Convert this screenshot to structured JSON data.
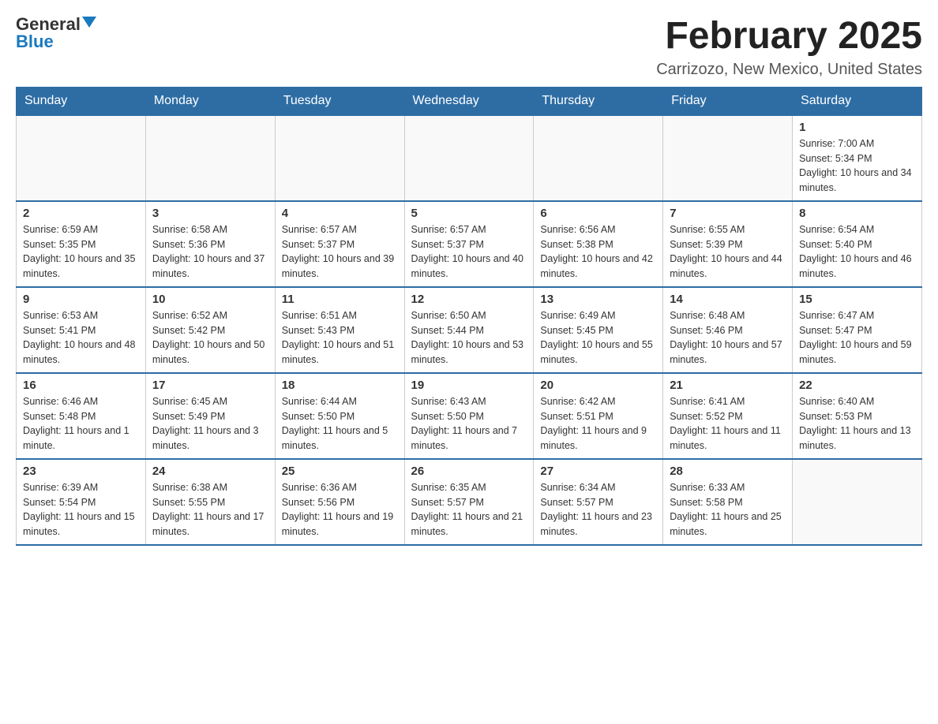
{
  "header": {
    "logo_general": "General",
    "logo_blue": "Blue",
    "month_title": "February 2025",
    "location": "Carrizozo, New Mexico, United States"
  },
  "days_of_week": [
    "Sunday",
    "Monday",
    "Tuesday",
    "Wednesday",
    "Thursday",
    "Friday",
    "Saturday"
  ],
  "weeks": [
    [
      {
        "day": "",
        "info": ""
      },
      {
        "day": "",
        "info": ""
      },
      {
        "day": "",
        "info": ""
      },
      {
        "day": "",
        "info": ""
      },
      {
        "day": "",
        "info": ""
      },
      {
        "day": "",
        "info": ""
      },
      {
        "day": "1",
        "info": "Sunrise: 7:00 AM\nSunset: 5:34 PM\nDaylight: 10 hours and 34 minutes."
      }
    ],
    [
      {
        "day": "2",
        "info": "Sunrise: 6:59 AM\nSunset: 5:35 PM\nDaylight: 10 hours and 35 minutes."
      },
      {
        "day": "3",
        "info": "Sunrise: 6:58 AM\nSunset: 5:36 PM\nDaylight: 10 hours and 37 minutes."
      },
      {
        "day": "4",
        "info": "Sunrise: 6:57 AM\nSunset: 5:37 PM\nDaylight: 10 hours and 39 minutes."
      },
      {
        "day": "5",
        "info": "Sunrise: 6:57 AM\nSunset: 5:37 PM\nDaylight: 10 hours and 40 minutes."
      },
      {
        "day": "6",
        "info": "Sunrise: 6:56 AM\nSunset: 5:38 PM\nDaylight: 10 hours and 42 minutes."
      },
      {
        "day": "7",
        "info": "Sunrise: 6:55 AM\nSunset: 5:39 PM\nDaylight: 10 hours and 44 minutes."
      },
      {
        "day": "8",
        "info": "Sunrise: 6:54 AM\nSunset: 5:40 PM\nDaylight: 10 hours and 46 minutes."
      }
    ],
    [
      {
        "day": "9",
        "info": "Sunrise: 6:53 AM\nSunset: 5:41 PM\nDaylight: 10 hours and 48 minutes."
      },
      {
        "day": "10",
        "info": "Sunrise: 6:52 AM\nSunset: 5:42 PM\nDaylight: 10 hours and 50 minutes."
      },
      {
        "day": "11",
        "info": "Sunrise: 6:51 AM\nSunset: 5:43 PM\nDaylight: 10 hours and 51 minutes."
      },
      {
        "day": "12",
        "info": "Sunrise: 6:50 AM\nSunset: 5:44 PM\nDaylight: 10 hours and 53 minutes."
      },
      {
        "day": "13",
        "info": "Sunrise: 6:49 AM\nSunset: 5:45 PM\nDaylight: 10 hours and 55 minutes."
      },
      {
        "day": "14",
        "info": "Sunrise: 6:48 AM\nSunset: 5:46 PM\nDaylight: 10 hours and 57 minutes."
      },
      {
        "day": "15",
        "info": "Sunrise: 6:47 AM\nSunset: 5:47 PM\nDaylight: 10 hours and 59 minutes."
      }
    ],
    [
      {
        "day": "16",
        "info": "Sunrise: 6:46 AM\nSunset: 5:48 PM\nDaylight: 11 hours and 1 minute."
      },
      {
        "day": "17",
        "info": "Sunrise: 6:45 AM\nSunset: 5:49 PM\nDaylight: 11 hours and 3 minutes."
      },
      {
        "day": "18",
        "info": "Sunrise: 6:44 AM\nSunset: 5:50 PM\nDaylight: 11 hours and 5 minutes."
      },
      {
        "day": "19",
        "info": "Sunrise: 6:43 AM\nSunset: 5:50 PM\nDaylight: 11 hours and 7 minutes."
      },
      {
        "day": "20",
        "info": "Sunrise: 6:42 AM\nSunset: 5:51 PM\nDaylight: 11 hours and 9 minutes."
      },
      {
        "day": "21",
        "info": "Sunrise: 6:41 AM\nSunset: 5:52 PM\nDaylight: 11 hours and 11 minutes."
      },
      {
        "day": "22",
        "info": "Sunrise: 6:40 AM\nSunset: 5:53 PM\nDaylight: 11 hours and 13 minutes."
      }
    ],
    [
      {
        "day": "23",
        "info": "Sunrise: 6:39 AM\nSunset: 5:54 PM\nDaylight: 11 hours and 15 minutes."
      },
      {
        "day": "24",
        "info": "Sunrise: 6:38 AM\nSunset: 5:55 PM\nDaylight: 11 hours and 17 minutes."
      },
      {
        "day": "25",
        "info": "Sunrise: 6:36 AM\nSunset: 5:56 PM\nDaylight: 11 hours and 19 minutes."
      },
      {
        "day": "26",
        "info": "Sunrise: 6:35 AM\nSunset: 5:57 PM\nDaylight: 11 hours and 21 minutes."
      },
      {
        "day": "27",
        "info": "Sunrise: 6:34 AM\nSunset: 5:57 PM\nDaylight: 11 hours and 23 minutes."
      },
      {
        "day": "28",
        "info": "Sunrise: 6:33 AM\nSunset: 5:58 PM\nDaylight: 11 hours and 25 minutes."
      },
      {
        "day": "",
        "info": ""
      }
    ]
  ]
}
